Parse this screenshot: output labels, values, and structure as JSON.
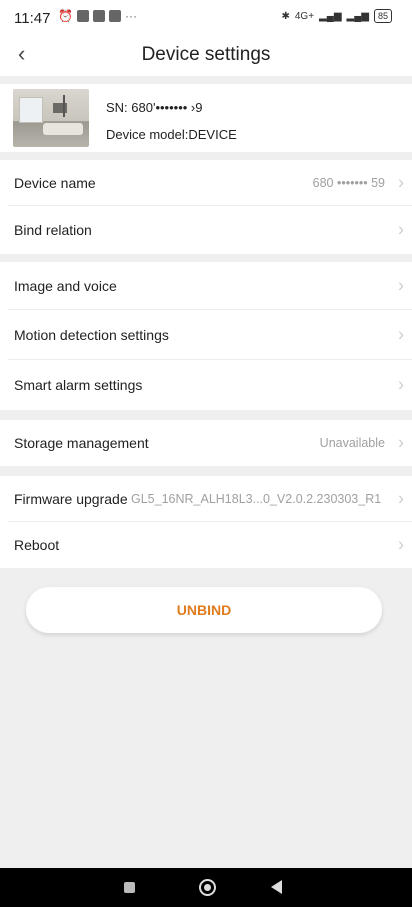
{
  "status": {
    "time": "11:47",
    "network": "4G+",
    "battery": "85"
  },
  "header": {
    "back_glyph": "‹",
    "title": "Device settings"
  },
  "device": {
    "sn_label": "SN: 680'••••••• ›9",
    "model_label": "Device model:DEVICE"
  },
  "rows": [
    {
      "label": "Device name",
      "value": "680 ••••••• 59"
    },
    {
      "label": "Bind relation",
      "value": ""
    },
    {
      "label": "Image and voice",
      "value": ""
    },
    {
      "label": "Motion detection settings",
      "value": ""
    },
    {
      "label": "Smart alarm settings",
      "value": ""
    },
    {
      "label": "Storage management",
      "value": "Unavailable"
    },
    {
      "label": "Firmware upgrade",
      "value": "GL5_16NR_ALH18L3...0_V2.0.2.230303_R1"
    },
    {
      "label": "Reboot",
      "value": ""
    }
  ],
  "chevron": "›",
  "unbind_label": "UNBIND",
  "colors": {
    "accent": "#e07b1e",
    "background": "#efefef"
  }
}
